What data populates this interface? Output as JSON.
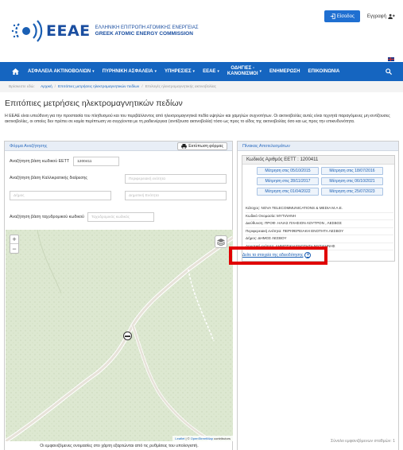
{
  "header": {
    "logo_acronym": "EEAE",
    "logo_greek": "ΕΛΛΗΝΙΚΗ ΕΠΙΤΡΟΠΗ ΑΤΟΜΙΚΗΣ ΕΝΕΡΓΕΙΑΣ",
    "logo_english": "GREEK ATOMIC ENERGY COMMISSION",
    "login_label": "Είσοδος",
    "register_label": "Εγγραφή"
  },
  "nav": {
    "items": [
      {
        "label": "ΑΣΦΑΛΕΙΑ ΑΚΤΙΝΟΒΟΛΙΩΝ"
      },
      {
        "label": "ΠΥΡΗΝΙΚΗ ΑΣΦΑΛΕΙΑ"
      },
      {
        "label": "ΥΠΗΡΕΣΙΕΣ"
      },
      {
        "label": "ΕΕΑΕ"
      }
    ],
    "odigies_line1": "ΟΔΗΓΙΕΣ -",
    "odigies_line2": "ΚΑΝΟΝΙΣΜΟΙ",
    "enimerosi": "ΕΝΗΜΕΡΩΣΗ",
    "epikoinonia": "ΕΠΙΚΟΙΝΩΝΙΑ"
  },
  "breadcrumb": {
    "prefix": "Βρίσκεστε εδώ:",
    "home": "Αρχική",
    "parent": "Επιτόπιες μετρήσεις ηλεκτρομαγνητικών πεδίων",
    "current": "Επιλογές ηλεκτρομαγνητικής ακτινοβολίας"
  },
  "page": {
    "title": "Επιτόπιες μετρήσεις ηλεκτρομαγνητικών πεδίων",
    "intro": "Η ΕΕΑΕ είναι υπεύθυνη για την προστασία του πληθυσμού και του περιβάλλοντος από ηλεκτρομαγνητικά πεδία υψηλών και χαμηλών συχνοτήτων. Οι ακτινοβολίες αυτές είναι τεχνητά παραγόμενες μη ιοντίζουσες ακτινοβολίες, οι οποίες δεν πρέπει σε καμία περίπτωση να συγχέονται με τη ραδιενέργεια (ιοντίζουσα ακτινοβολία) τόσο ως προς το είδος της ακτινοβολίας όσο και ως προς την επικινδυνότητα."
  },
  "search_form": {
    "heading": "Φόρμα Αναζήτησης",
    "print_label": "Εκτύπωση φόρμας",
    "eett_label": "Αναζήτηση βάση κωδικού ΕΕΤΤ",
    "eett_value": "1200411",
    "kallikratis_label": "Αναζήτηση βάση Καλλικρατικής διαίρεσης",
    "periphery_placeholder": "Περιφερειακή ενότητα",
    "dimos_placeholder": "Δήμος",
    "dimotiki_placeholder": "Δημοτική Ενότητα",
    "postal_label": "Αναζήτηση βάση ταχυδρομικού κωδικού",
    "postal_placeholder": "Ταχυδρομικός κωδικός"
  },
  "map": {
    "zoom_in": "+",
    "zoom_out": "−",
    "attribution_leaflet": "Leaflet",
    "attribution_sep": " | © ",
    "attribution_osm": "OpenStreetMap",
    "attribution_tail": " contributors",
    "note": "Οι εμφανιζόμενες ονομασίες στο χάρτη εξαρτώνται από τις ρυθμίσεις του υπολογιστή."
  },
  "results": {
    "heading": "Πίνακας Αποτελεσμάτων",
    "code_title": "Κωδικός Αριθμός ΕΕΤΤ : 1200411",
    "measurements": [
      "Μέτρηση στις 05/10/2015",
      "Μέτρηση στις 18/07/2016",
      "Μέτρηση στις 28/11/2017",
      "Μέτρηση στις 06/10/2021",
      "Μέτρηση στις 01/04/2022",
      "Μέτρηση στις 25/07/2023"
    ],
    "info": [
      "Κάτοχος: NOVA TELECOMMUNICATIONS & MEDIA Μ.Α.Ε.",
      "Κωδικό Ονομασία: ΜΥΤΙΛΗΝΗ",
      "Διεύθυνση: ΠΡΟΦ. ΗΛΙΑΣ ΠΛΗΣΙΟΝ ΛΟΥΤΡΟΝ , ΛΕΣΒΟΣ",
      "Περιφερειακή ενότητα: ΠΕΡΙΦΕΡΕΙΑΚΗ ΕΝΟΤΗΤΑ ΛΕΣΒΟΥ",
      "Δήμος: ΔΗΜΟΣ ΛΕΣΒΟΥ",
      "Δημοτική ενότητα: ΔΗΜΟΤΙΚΗ ΕΝΟΤΗΤΑ ΜΥΤΙΛΗΝΗΣ"
    ],
    "details_link": "Δείτε τα στοιχεία της αδειοδότησης",
    "details_icon": "+",
    "station_total": "Σύνολο εμφανιζόμενων σταθμών: 1"
  },
  "colors": {
    "brand_blue": "#1565c0",
    "highlight_red": "#e00000"
  }
}
